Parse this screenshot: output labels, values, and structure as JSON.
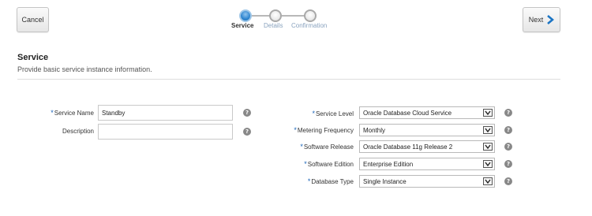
{
  "header": {
    "cancel_label": "Cancel",
    "next_label": "Next"
  },
  "train": {
    "steps": [
      {
        "label": "Service",
        "state": "current"
      },
      {
        "label": "Details",
        "state": "pending"
      },
      {
        "label": "Confirmation",
        "state": "pending"
      }
    ]
  },
  "section": {
    "title": "Service",
    "subtitle": "Provide basic service instance information."
  },
  "left_form": {
    "service_name": {
      "label": "Service Name",
      "required": true,
      "value": "Standby"
    },
    "description": {
      "label": "Description",
      "required": false,
      "value": ""
    }
  },
  "right_form": {
    "service_level": {
      "label": "Service Level",
      "required": true,
      "value": "Oracle Database Cloud Service"
    },
    "metering_frequency": {
      "label": "Metering Frequency",
      "required": true,
      "value": "Monthly"
    },
    "software_release": {
      "label": "Software Release",
      "required": true,
      "value": "Oracle Database 11g Release 2"
    },
    "software_edition": {
      "label": "Software Edition",
      "required": true,
      "value": "Enterprise Edition"
    },
    "database_type": {
      "label": "Database Type",
      "required": true,
      "value": "Single Instance"
    }
  },
  "icons": {
    "help": "help-icon",
    "next_arrow": "chevron-right-icon",
    "select_caret": "chevron-down-icon"
  },
  "colors": {
    "required_marker": "#1a64b8",
    "train_current": "#2f86d0",
    "train_pending_label": "#8aa3bf",
    "next_arrow": "#1a74c4"
  },
  "glyphs": {
    "required": "*",
    "help": "?"
  }
}
